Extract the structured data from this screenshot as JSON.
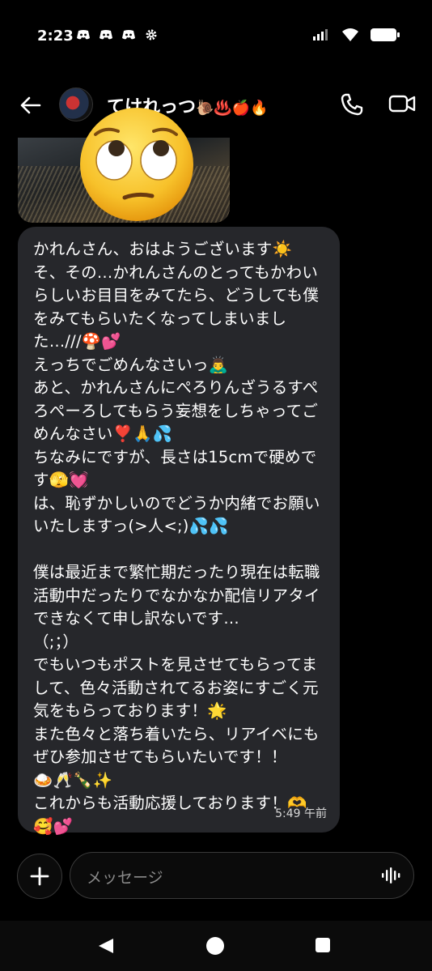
{
  "status_bar": {
    "time": "2:23",
    "icons_left": [
      "discord-icon",
      "discord-icon",
      "discord-icon",
      "gear-icon"
    ],
    "icons_right": [
      "signal-icon",
      "wifi-icon",
      "battery-icon"
    ]
  },
  "header": {
    "contact_name": "てけれっつ",
    "name_emojis": "🐌♨️🍎🔥"
  },
  "messages": [
    {
      "type": "image",
      "overlay_emoji": "face-with-rolling-eyes"
    },
    {
      "type": "text",
      "text": "かれんさん、おはようございます☀️\nそ、その…かれんさんのとってもかわいらしいお目目をみてたら、どうしても僕をみてもらいたくなってしまいました…///🍄💕\nえっちでごめんなさいっ🙇‍♂️\nあと、かれんさんにぺろりんざうるすぺろぺーろしてもらう妄想をしちゃってごめんなさい❣️🙏💦\nちなみにですが、長さは15cmで硬めです🫣💓\nは、恥ずかしいのでどうか内緒でお願いいたしますっ(>人<;)💦💦\n\n僕は最近まで繁忙期だったり現在は転職活動中だったりでなかなか配信リアタイできなくて申し訳ないです…\n（;；）\nでもいつもポストを見させてもらってまして、色々活動されてるお姿にすごく元気をもらっております！🌟\nまた色々と落ち着いたら、リアイベにもぜひ参加させてもらいたいです！！\n🍛🥂🍾✨\nこれからも活動応援しております！🫶\n🥰💕",
      "time": "5:49 午前"
    }
  ],
  "composer": {
    "placeholder": "メッセージ"
  },
  "colors": {
    "background": "#000000",
    "bubble": "#26272b",
    "text": "#ffffff",
    "muted": "#8a8a8a"
  }
}
